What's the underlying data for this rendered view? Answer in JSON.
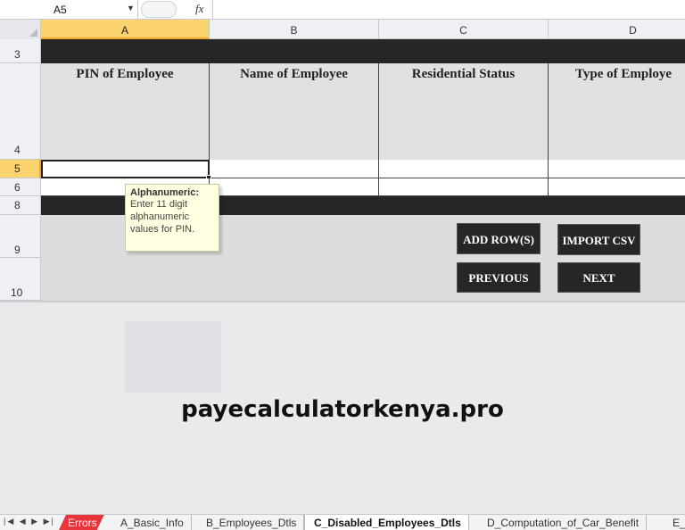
{
  "formula_bar": {
    "name_box": "A5",
    "fx_label": "fx",
    "formula": ""
  },
  "columns": [
    "A",
    "B",
    "C",
    "D"
  ],
  "active_column": "A",
  "rows": [
    "3",
    "4",
    "5",
    "6",
    "8",
    "9",
    "10"
  ],
  "active_row": "5",
  "table_headers": [
    "PIN of Employee",
    "Name of Employee",
    "Residential Status",
    "Type of Employe"
  ],
  "tooltip": {
    "title": "Alphanumeric:",
    "body": "Enter 11 digit alphanumeric values for PIN."
  },
  "buttons": {
    "add_rows": "ADD ROW(S)",
    "import_csv": "IMPORT CSV",
    "previous": "PREVIOUS",
    "next": "NEXT"
  },
  "watermark": "payecalculatorkenya.pro",
  "sheet_tabs": [
    {
      "label": "Errors",
      "state": "error"
    },
    {
      "label": "A_Basic_Info",
      "state": "normal"
    },
    {
      "label": "B_Employees_Dtls",
      "state": "normal"
    },
    {
      "label": "C_Disabled_Employees_Dtls",
      "state": "active"
    },
    {
      "label": "D_Computation_of_Car_Benefit",
      "state": "normal"
    },
    {
      "label": "E_",
      "state": "normal"
    }
  ],
  "colors": {
    "active_header": "#fbd470",
    "band": "#262626",
    "tooltip_bg": "#ffffe1",
    "error_tab": "#e8353b"
  }
}
